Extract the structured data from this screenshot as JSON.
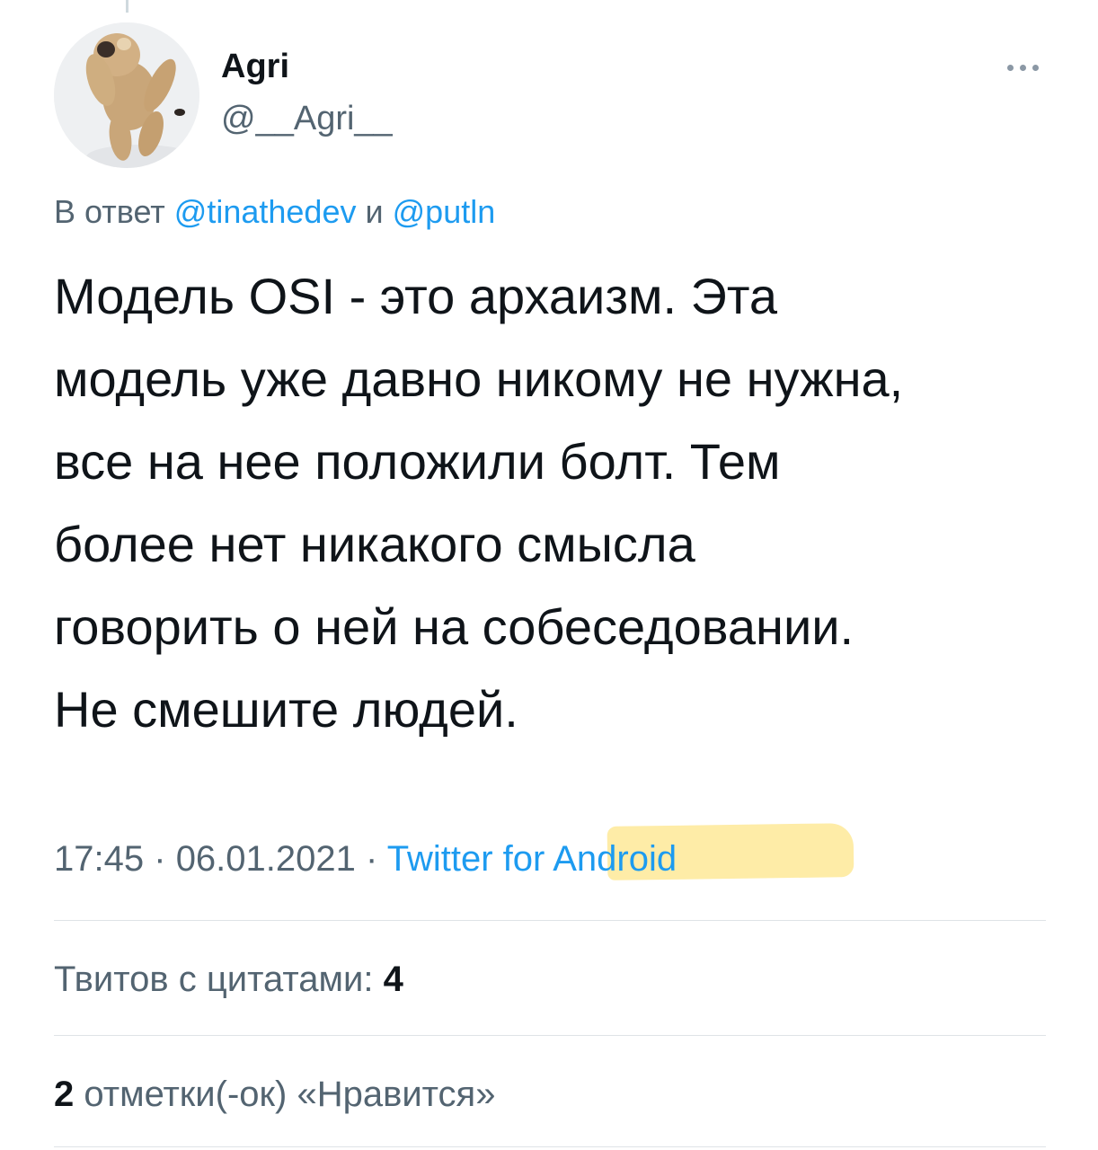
{
  "tweet": {
    "author": {
      "display_name": "Agri",
      "handle": "@__Agri__"
    },
    "reply_to": {
      "prefix": "В ответ",
      "users": [
        "@tinathedev",
        "@putln"
      ],
      "joiner": "и"
    },
    "text": "Модель OSI - это архаизм. Эта\nмодель уже давно никому не нужна,\nвсе на нее положили болт. Тем\nболее нет никакого смысла\nговорить о ней на собеседовании.\nНе смешите людей.",
    "time": "17:45",
    "date": "06.01.2021",
    "separator": "·",
    "source": "Twitter for Android"
  },
  "stats": {
    "quote_tweets": {
      "label": "Твитов с цитатами:",
      "count": "4"
    },
    "likes": {
      "count": "2",
      "label": "отметки(-ок) «Нравится»"
    }
  },
  "colors": {
    "link": "#1d9bf0",
    "secondary_text": "#536471",
    "primary_text": "#0f1419",
    "highlight": "#fde58a"
  },
  "icons": {
    "more": "more-horizontal-icon"
  }
}
